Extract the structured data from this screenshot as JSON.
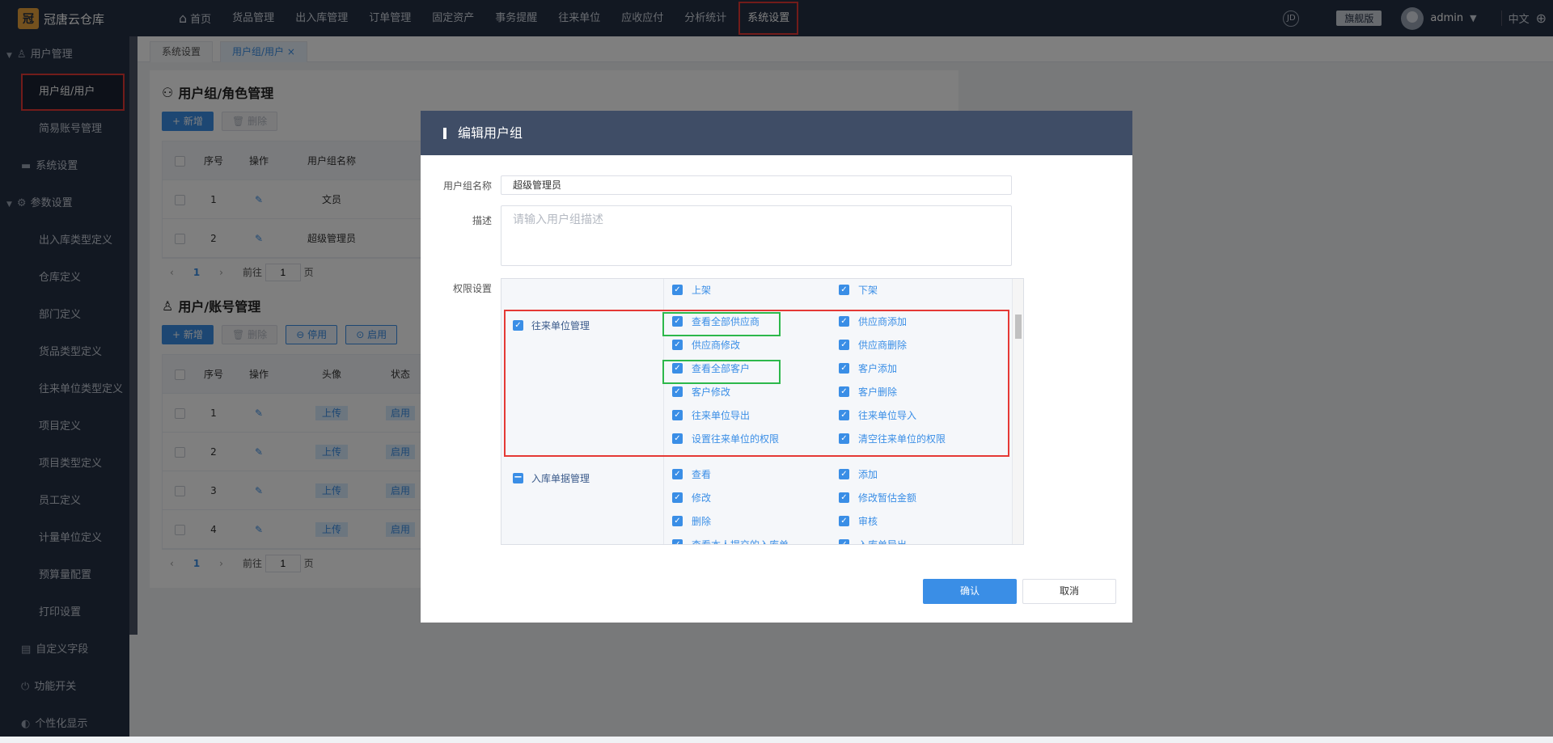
{
  "app": {
    "name": "冠唐云仓库",
    "logo_char": "冠"
  },
  "topnav": [
    {
      "label": "首页",
      "icon": "home-icon"
    },
    {
      "label": "货品管理"
    },
    {
      "label": "出入库管理"
    },
    {
      "label": "订单管理"
    },
    {
      "label": "固定资产"
    },
    {
      "label": "事务提醒"
    },
    {
      "label": "往来单位"
    },
    {
      "label": "应收应付"
    },
    {
      "label": "分析统计"
    },
    {
      "label": "系统设置",
      "active": true
    }
  ],
  "topright": {
    "badge": "旗舰版",
    "user": "admin",
    "lang": "中文",
    "circle_icon_text": "JD"
  },
  "sidebar": {
    "user_mgmt": "用户管理",
    "user_group": "用户组/用户",
    "simple_account": "简易账号管理",
    "system_settings": "系统设置",
    "param_settings": "参数设置",
    "params": [
      "出入库类型定义",
      "仓库定义",
      "部门定义",
      "货品类型定义",
      "往来单位类型定义",
      "项目定义",
      "项目类型定义",
      "员工定义",
      "计量单位定义",
      "预算量配置",
      "打印设置"
    ],
    "custom_fields": "自定义字段",
    "feature_switch": "功能开关",
    "personalize": "个性化显示"
  },
  "tabs": {
    "t1": "系统设置",
    "t2": "用户组/用户",
    "close": "×"
  },
  "group_panel": {
    "title": "用户组/角色管理",
    "add": "+ 新增",
    "del": "删除",
    "headers": [
      "序号",
      "操作",
      "用户组名称"
    ],
    "rows": [
      {
        "no": "1",
        "name": "文员"
      },
      {
        "no": "2",
        "name": "超级管理员"
      }
    ],
    "pager": {
      "page": "1",
      "goto": "前往",
      "val": "1",
      "unit": "页"
    }
  },
  "user_panel": {
    "title": "用户/账号管理",
    "add": "+ 新增",
    "del": "删除",
    "disable": "停用",
    "enable": "启用",
    "headers": [
      "序号",
      "操作",
      "头像",
      "状态"
    ],
    "rows": [
      {
        "no": "1"
      },
      {
        "no": "2"
      },
      {
        "no": "3"
      },
      {
        "no": "4"
      }
    ],
    "upload": "上传",
    "status": "启用",
    "pager": {
      "page": "1",
      "goto": "前往",
      "val": "1",
      "unit": "页"
    }
  },
  "modal": {
    "title": "编辑用户组",
    "name_label": "用户组名称",
    "name_value": "超级管理员",
    "desc_label": "描述",
    "desc_placeholder": "请输入用户组描述",
    "perm_label": "权限设置",
    "top_items": [
      "上架",
      "下架"
    ],
    "sections": [
      {
        "category": "往来单位管理",
        "checked": "full",
        "items": [
          [
            "查看全部供应商",
            "供应商添加"
          ],
          [
            "供应商修改",
            "供应商删除"
          ],
          [
            "查看全部客户",
            "客户添加"
          ],
          [
            "客户修改",
            "客户删除"
          ],
          [
            "往来单位导出",
            "往来单位导入"
          ],
          [
            "设置往来单位的权限",
            "清空往来单位的权限"
          ]
        ]
      },
      {
        "category": "入库单据管理",
        "checked": "partial",
        "items": [
          [
            "查看",
            "添加"
          ],
          [
            "修改",
            "修改暂估金额"
          ],
          [
            "删除",
            "审核"
          ],
          [
            "查看本人提交的入库单",
            "入库单导出"
          ]
        ]
      }
    ],
    "confirm": "确认",
    "cancel": "取消"
  },
  "colors": {
    "accent": "#3a8ee6",
    "nav_bg": "#253044",
    "highlight_red": "#e53935",
    "highlight_green": "#2db84b"
  }
}
